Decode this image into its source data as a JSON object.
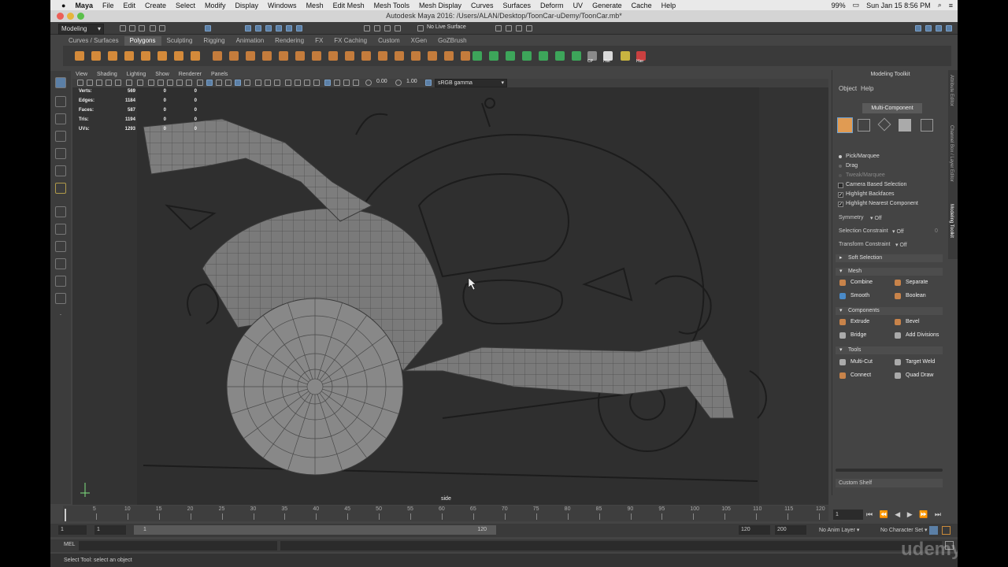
{
  "mac_menu": {
    "app_name": "Maya",
    "items": [
      "File",
      "Edit",
      "Create",
      "Select",
      "Modify",
      "Display",
      "Windows",
      "Mesh",
      "Edit Mesh",
      "Mesh Tools",
      "Mesh Display",
      "Curves",
      "Surfaces",
      "Deform",
      "UV",
      "Generate",
      "Cache",
      "Help"
    ],
    "battery": "99%",
    "datetime": "Sun Jan 15  8:56 PM"
  },
  "window_title": "Autodesk Maya 2016: /Users/ALAN/Desktop/ToonCar-uDemy/ToonCar.mb*",
  "status_line": {
    "mode": "Modeling",
    "live_surface": "No Live Surface"
  },
  "shelf": {
    "tabs": [
      "Curves / Surfaces",
      "Polygons",
      "Sculpting",
      "Rigging",
      "Animation",
      "Rendering",
      "FX",
      "FX Caching",
      "Custom",
      "XGen",
      "GoZBrush"
    ],
    "active_tab": "Polygons",
    "icon_labels": [
      "CP",
      "Hist",
      "Hier"
    ]
  },
  "viewport": {
    "menu": [
      "View",
      "Shading",
      "Lighting",
      "Show",
      "Renderer",
      "Panels"
    ],
    "field_a": "0.00",
    "field_b": "1.00",
    "color_space": "sRGB gamma",
    "camera": "side",
    "hud": [
      {
        "label": "Verts:",
        "v1": "569",
        "v2": "0",
        "v3": "0"
      },
      {
        "label": "Edges:",
        "v1": "1184",
        "v2": "0",
        "v3": "0"
      },
      {
        "label": "Faces:",
        "v1": "587",
        "v2": "0",
        "v3": "0"
      },
      {
        "label": "Tris:",
        "v1": "1194",
        "v2": "0",
        "v3": "0"
      },
      {
        "label": "UVs:",
        "v1": "1293",
        "v2": "0",
        "v3": "0"
      }
    ]
  },
  "toolkit": {
    "title": "Modeling Toolkit",
    "menu": [
      "Object",
      "Help"
    ],
    "mode": "Multi-Component",
    "selection": {
      "pick": "Pick/Marquee",
      "drag": "Drag",
      "tweak": "Tweak/Marquee"
    },
    "options": [
      "Camera Based Selection",
      "Highlight Backfaces",
      "Highlight Nearest Component"
    ],
    "symmetry": {
      "label": "Symmetry",
      "value": "Off"
    },
    "selection_constraint": {
      "label": "Selection Constraint",
      "value": "Off",
      "num": "0"
    },
    "transform_constraint": {
      "label": "Transform Constraint",
      "value": "Off"
    },
    "soft_selection": "Soft Selection",
    "sections": {
      "mesh": {
        "title": "Mesh",
        "buttons": [
          "Combine",
          "Separate",
          "Smooth",
          "Boolean"
        ]
      },
      "components": {
        "title": "Components",
        "buttons": [
          "Extrude",
          "Bevel",
          "Bridge",
          "Add Divisions"
        ]
      },
      "tools": {
        "title": "Tools",
        "buttons": [
          "Multi-Cut",
          "Target Weld",
          "Connect",
          "Quad Draw"
        ]
      }
    },
    "custom_shelf": "Custom Shelf"
  },
  "side_tabs": [
    "Attribute Editor",
    "Channel Box / Layer Editor",
    "Modeling Toolkit"
  ],
  "timeline": {
    "ticks": [
      "5",
      "10",
      "15",
      "20",
      "25",
      "30",
      "35",
      "40",
      "45",
      "50",
      "55",
      "60",
      "65",
      "70",
      "75",
      "80",
      "85",
      "90",
      "95",
      "100",
      "105",
      "110",
      "115",
      "120"
    ],
    "current_frame": "1",
    "current_field": "1"
  },
  "range": {
    "start": "1",
    "start2": "1",
    "slider_start": "1",
    "slider_end": "120",
    "end": "120",
    "end2": "200",
    "anim_layer": "No Anim Layer",
    "char_set": "No Character Set"
  },
  "command": {
    "label": "MEL"
  },
  "help_line": "Select Tool: select an object",
  "watermark": "udemy"
}
